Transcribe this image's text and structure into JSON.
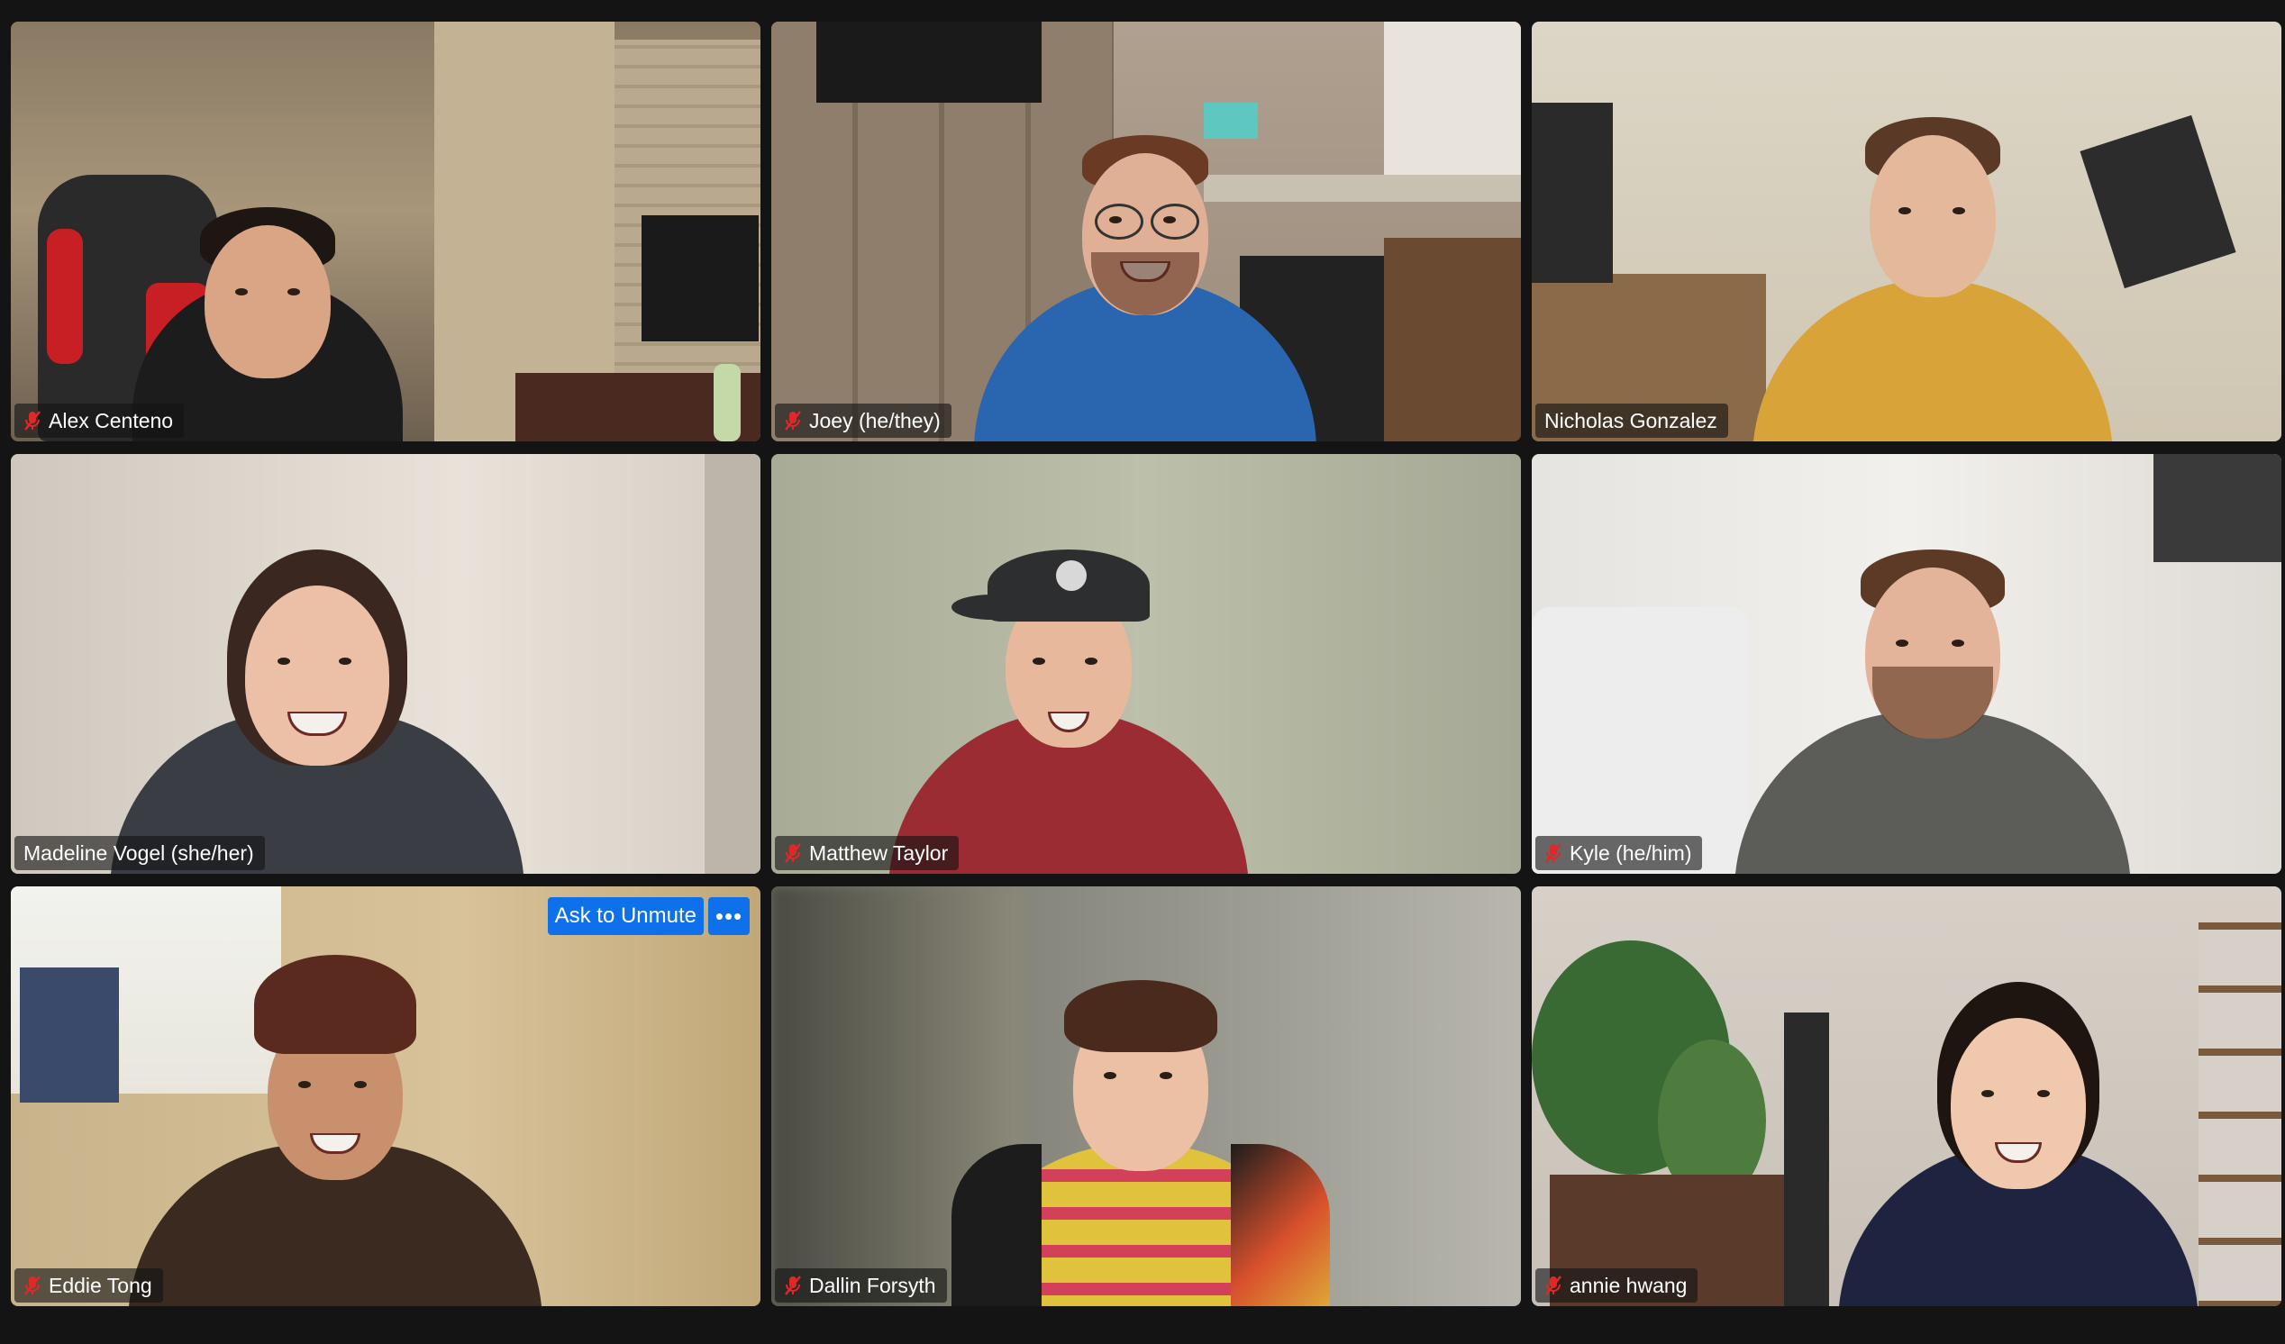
{
  "meeting": {
    "view": "gallery",
    "accent_speaker_color": "#3fd35a",
    "muted_icon_color": "#e02828",
    "button_color": "#0e71eb"
  },
  "participants": [
    {
      "name": "Alex Centeno",
      "muted": true,
      "active_speaker": false
    },
    {
      "name": "Joey (he/they)",
      "muted": true,
      "active_speaker": false
    },
    {
      "name": "Nicholas Gonzalez",
      "muted": false,
      "active_speaker": false
    },
    {
      "name": "Madeline Vogel (she/her)",
      "muted": false,
      "active_speaker": true
    },
    {
      "name": "Matthew Taylor",
      "muted": true,
      "active_speaker": false
    },
    {
      "name": "Kyle (he/him)",
      "muted": true,
      "active_speaker": false
    },
    {
      "name": "Eddie Tong",
      "muted": true,
      "active_speaker": false
    },
    {
      "name": "Dallin Forsyth",
      "muted": true,
      "active_speaker": false
    },
    {
      "name": "annie hwang",
      "muted": true,
      "active_speaker": false
    }
  ],
  "hover_controls": {
    "ask_to_unmute_label": "Ask to Unmute",
    "more_icon": "ellipsis-icon"
  }
}
